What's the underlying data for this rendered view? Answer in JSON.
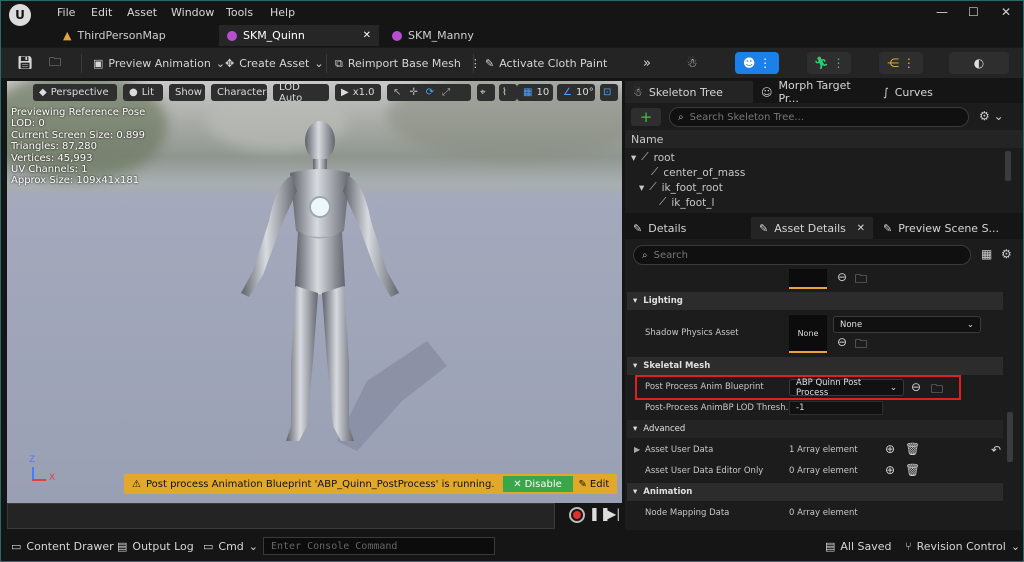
{
  "menu": [
    "File",
    "Edit",
    "Asset",
    "Window",
    "Tools",
    "Help"
  ],
  "tabs": [
    {
      "label": "ThirdPersonMap",
      "icon": "map-icon",
      "color": "#e8a33c"
    },
    {
      "label": "SKM_Quinn",
      "icon": "skeletal-mesh-icon",
      "color": "#b84fd1",
      "active": true
    },
    {
      "label": "SKM_Manny",
      "icon": "skeletal-mesh-icon",
      "color": "#b84fd1"
    }
  ],
  "toolbar": {
    "preview_animation": "Preview Animation",
    "create_asset": "Create Asset",
    "reimport": "Reimport Base Mesh",
    "cloth_paint": "Activate Cloth Paint",
    "mode_colors": {
      "active": "#1d7fe8",
      "anim": "#2ecc71",
      "blueprint": "#f0b33a"
    }
  },
  "viewport": {
    "perspective": "Perspective",
    "lit": "Lit",
    "show": "Show",
    "character": "Character",
    "lod": "LOD Auto",
    "speed": "x1.0",
    "grid_snap": "10",
    "angle_snap": "10°",
    "stats": [
      "Previewing Reference Pose",
      "LOD: 0",
      "Current Screen Size: 0.899",
      "Triangles: 87,280",
      "Vertices: 45,993",
      "UV Channels: 1",
      "Approx Size: 109x41x181"
    ],
    "notice": "Post process Animation Blueprint 'ABP_Quinn_PostProcess' is running.",
    "disable": "Disable",
    "edit": "Edit"
  },
  "skeleton": {
    "tabs": [
      "Skeleton Tree",
      "Morph Target Pr...",
      "Curves"
    ],
    "search_placeholder": "Search Skeleton Tree...",
    "header": "Name",
    "bones": [
      "root",
      "center_of_mass",
      "ik_foot_root",
      "ik_foot_l"
    ]
  },
  "details": {
    "tabs": [
      "Details",
      "Asset Details",
      "Preview Scene S..."
    ],
    "search_placeholder": "Search",
    "categories": {
      "lighting": "Lighting",
      "skeletal_mesh": "Skeletal Mesh",
      "advanced": "Advanced",
      "animation": "Animation"
    },
    "props": {
      "shadow_physics_label": "Shadow Physics Asset",
      "shadow_thumb": "None",
      "shadow_value": "None",
      "pp_anim_label": "Post Process Anim Blueprint",
      "pp_anim_value": "ABP Quinn Post Process",
      "pp_lod_label": "Post-Process AnimBP LOD Thresh...",
      "pp_lod_value": "-1",
      "user_data_label": "Asset User Data",
      "user_data_value": "1 Array element",
      "user_data_editor_label": "Asset User Data Editor Only",
      "user_data_editor_value": "0 Array element",
      "node_mapping_label": "Node Mapping Data",
      "node_mapping_value": "0 Array element"
    },
    "highlight_color": "#e02020"
  },
  "statusbar": {
    "content_drawer": "Content Drawer",
    "output_log": "Output Log",
    "cmd": "Cmd",
    "console_placeholder": "Enter Console Command",
    "all_saved": "All Saved",
    "revision": "Revision Control"
  }
}
